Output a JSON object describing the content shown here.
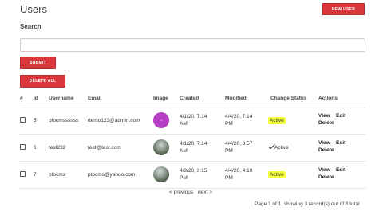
{
  "header": {
    "title": "Users",
    "new_user_label": "NEW USER"
  },
  "search": {
    "label": "Search",
    "value": "",
    "submit_label": "SUBMIT"
  },
  "bulk": {
    "delete_all_label": "DELETE ALL"
  },
  "table": {
    "columns": [
      "#",
      "Id",
      "Username",
      "Email",
      "Image",
      "Created",
      "Modified",
      "Change Status",
      "Actions"
    ],
    "rows": [
      {
        "id": "5",
        "username": "ptocmssssss",
        "email": "demo123@admin.com",
        "image": "purple-logo",
        "created_1": "4/1/20, 7:14",
        "created_2": "AM",
        "modified_1": "4/4/20, 7:14",
        "modified_2": "PM",
        "status": "Active",
        "status_style": "highlighted",
        "view": "View",
        "edit": "Edit",
        "delete": "Delete"
      },
      {
        "id": "6",
        "username": "test232",
        "email": "test@test.com",
        "image": "landscape-photo",
        "created_1": "4/1/20, 7:14",
        "created_2": "AM",
        "modified_1": "4/4/20, 3:57",
        "modified_2": "PM",
        "status": "Active",
        "status_style": "handwritten-check",
        "view": "View",
        "edit": "Edit",
        "delete": "Delete"
      },
      {
        "id": "7",
        "username": "ptocms",
        "email": "ptocms@yahoo.com",
        "image": "landscape-photo",
        "created_1": "4/3/20, 3:15",
        "created_2": "PM",
        "modified_1": "4/4/20, 4:19",
        "modified_2": "PM",
        "status": "Active",
        "status_style": "highlighted",
        "view": "View",
        "edit": "Edit",
        "delete": "Delete"
      }
    ]
  },
  "pagination": {
    "previous": "< previous",
    "next": "next >",
    "summary": "Page 1 of 1, showing 3 record(s) out of 3 total"
  },
  "colors": {
    "accent": "#d9373b",
    "highlight": "#f2ff3a",
    "avatar_purple": "#b63ec4"
  }
}
